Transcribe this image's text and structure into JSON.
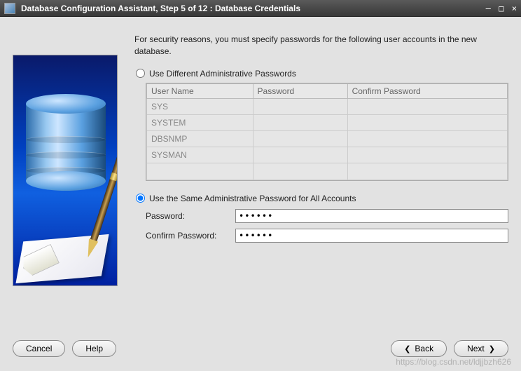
{
  "titlebar": {
    "title": "Database Configuration Assistant, Step 5 of 12 : Database Credentials"
  },
  "instruction": "For security reasons, you must specify passwords for the following user accounts in the new database.",
  "options": {
    "different": {
      "label": "Use Different Administrative Passwords",
      "selected": false
    },
    "same": {
      "label": "Use the Same Administrative Password for All Accounts",
      "selected": true
    }
  },
  "table": {
    "headers": [
      "User Name",
      "Password",
      "Confirm Password"
    ],
    "rows": [
      {
        "user": "SYS",
        "password": "",
        "confirm": ""
      },
      {
        "user": "SYSTEM",
        "password": "",
        "confirm": ""
      },
      {
        "user": "DBSNMP",
        "password": "",
        "confirm": ""
      },
      {
        "user": "SYSMAN",
        "password": "",
        "confirm": ""
      }
    ]
  },
  "form": {
    "password_label": "Password:",
    "confirm_label": "Confirm Password:",
    "password_value": "******",
    "confirm_value": "******"
  },
  "buttons": {
    "cancel": "Cancel",
    "help": "Help",
    "back": "Back",
    "next": "Next"
  },
  "watermark": "https://blog.csdn.net/ldjjbzh626"
}
